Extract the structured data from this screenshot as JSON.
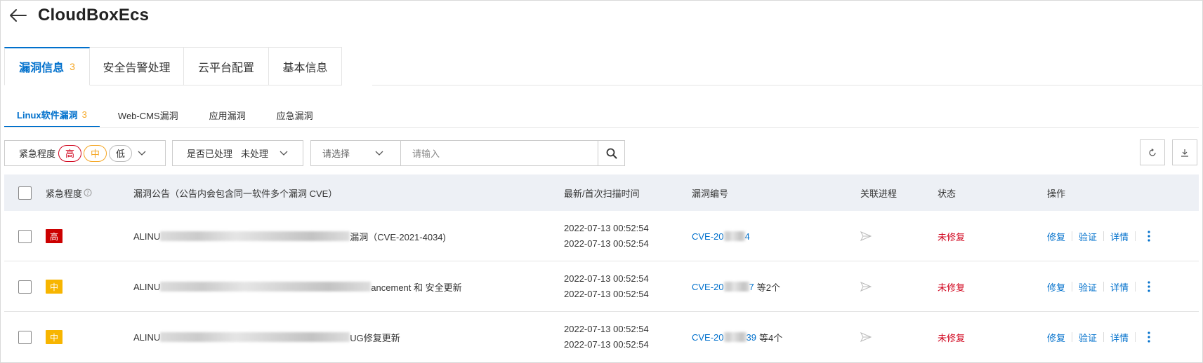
{
  "header": {
    "title": "CloudBoxEcs"
  },
  "main_tabs": [
    {
      "label": "漏洞信息",
      "count": "3",
      "active": true
    },
    {
      "label": "安全告警处理"
    },
    {
      "label": "云平台配置"
    },
    {
      "label": "基本信息"
    }
  ],
  "sub_tabs": [
    {
      "label": "Linux软件漏洞",
      "count": "3",
      "active": true
    },
    {
      "label": "Web-CMS漏洞"
    },
    {
      "label": "应用漏洞"
    },
    {
      "label": "应急漏洞"
    }
  ],
  "filters": {
    "urgency_label": "紧急程度",
    "levels": [
      "高",
      "中",
      "低"
    ],
    "processed_label": "是否已处理",
    "processed_value": "未处理",
    "select_placeholder": "请选择",
    "input_placeholder": "请输入"
  },
  "table": {
    "headers": {
      "urgency": "紧急程度",
      "notice": "漏洞公告（公告内会包含同一软件多个漏洞 CVE）",
      "scan_time": "最新/首次扫描时间",
      "vuln_id": "漏洞编号",
      "process": "关联进程",
      "status": "状态",
      "actions": "操作"
    },
    "rows": [
      {
        "level": "高",
        "notice_prefix": "ALINU",
        "notice_suffix": "漏洞（CVE-2021-4034)",
        "latest": "2022-07-13 00:52:54",
        "first": "2022-07-13 00:52:54",
        "cve_prefix": "CVE-20",
        "cve_suffix": "4",
        "cve_extra": "",
        "status": "未修复"
      },
      {
        "level": "中",
        "notice_prefix": "ALINU",
        "notice_suffix": "ancement 和 安全更新",
        "latest": "2022-07-13 00:52:54",
        "first": "2022-07-13 00:52:54",
        "cve_prefix": "CVE-20",
        "cve_suffix": "7",
        "cve_extra": "等2个",
        "status": "未修复"
      },
      {
        "level": "中",
        "notice_prefix": "ALINU",
        "notice_suffix": "UG修复更新",
        "latest": "2022-07-13 00:52:54",
        "first": "2022-07-13 00:52:54",
        "cve_prefix": "CVE-20",
        "cve_suffix": "39",
        "cve_extra": "等4个",
        "status": "未修复"
      }
    ],
    "actions": {
      "fix": "修复",
      "verify": "验证",
      "detail": "详情"
    }
  },
  "colors": {
    "accent": "#0070cc",
    "high": "#cc0000",
    "medium": "#f7b500",
    "count": "#f5a623"
  }
}
